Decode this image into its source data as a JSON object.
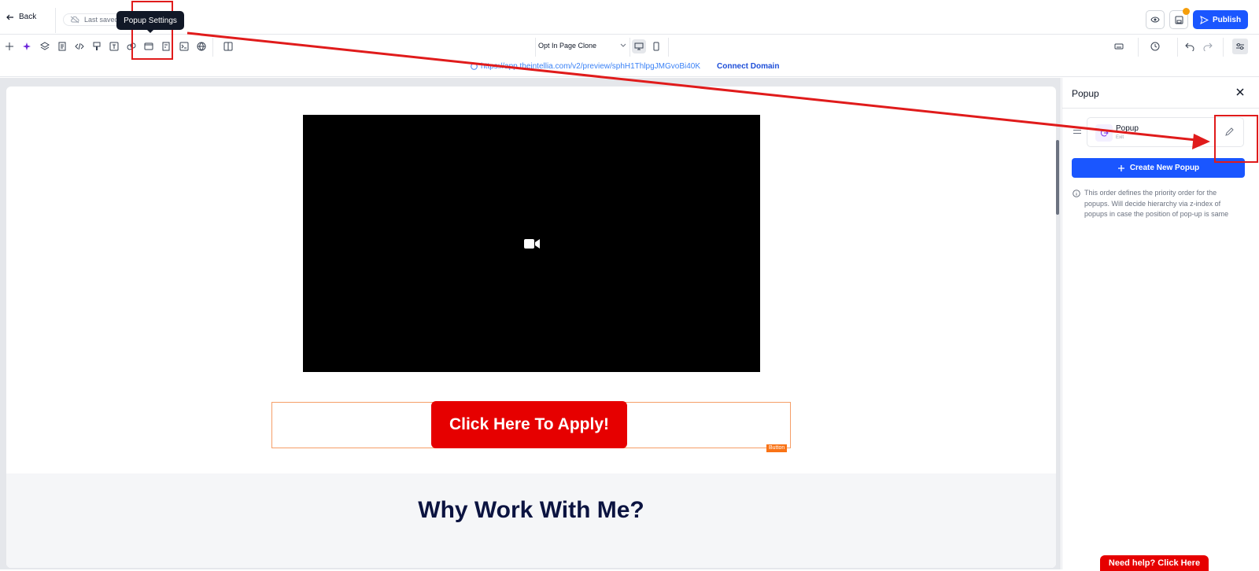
{
  "header": {
    "back_label": "Back",
    "saved_label": "Last saved",
    "tooltip": "Popup Settings",
    "publish_label": "Publish"
  },
  "toolbar": {
    "page_select": "Opt In Page Clone",
    "tools": [
      "plus-icon",
      "sparkle-icon",
      "layers-icon",
      "page-icon",
      "code-icon",
      "paint-icon",
      "text-icon",
      "link-icon",
      "popup-icon",
      "form-icon",
      "terminal-icon",
      "globe-icon",
      "columns-icon"
    ]
  },
  "urlbar": {
    "url": "https://app.theintellia.com/v2/preview/sphH1ThlpgJMGvoBi40K",
    "connect_label": "Connect Domain"
  },
  "canvas": {
    "cta_label": "Click Here To Apply!",
    "element_tag": "Button",
    "section_heading": "Why Work With Me?"
  },
  "panel": {
    "title": "Popup",
    "popup_item": {
      "name": "Popup",
      "trigger": "Exit"
    },
    "create_label": "Create New Popup",
    "info_text": "This order defines the priority order for the popups. Will decide hierarchy via z-index of popups in case the position of pop-up is same"
  },
  "help_label": "Need help? Click Here",
  "colors": {
    "primary": "#1a56ff",
    "cta": "#e60000",
    "heading": "#0b1340",
    "annotation": "#e01b1b"
  }
}
